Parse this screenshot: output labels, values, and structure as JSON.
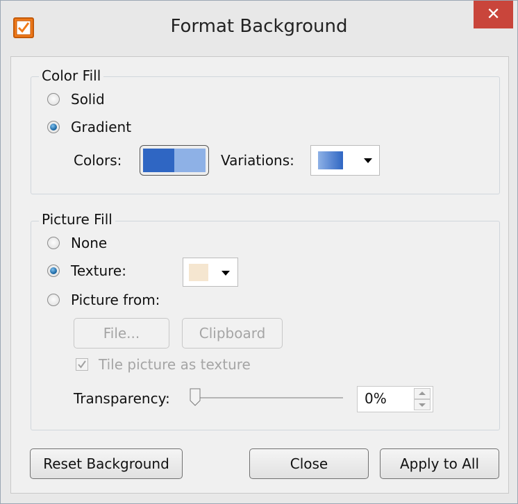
{
  "window": {
    "title": "Format Background",
    "close_glyph": "✕"
  },
  "color_fill": {
    "title": "Color Fill",
    "solid_label": "Solid",
    "gradient_label": "Gradient",
    "selected": "gradient",
    "colors_label": "Colors:",
    "colors": [
      "#2f66c3",
      "#8eb1e6"
    ],
    "variations_label": "Variations:"
  },
  "picture_fill": {
    "title": "Picture Fill",
    "none_label": "None",
    "texture_label": "Texture:",
    "picture_from_label": "Picture from:",
    "selected": "texture",
    "texture_color": "#f5e6d0",
    "file_button": "File...",
    "clipboard_button": "Clipboard",
    "tile_label": "Tile picture as texture",
    "tile_checked": true,
    "transparency_label": "Transparency:",
    "transparency_value": "0%",
    "transparency_percent": 0
  },
  "buttons": {
    "reset": "Reset Background",
    "close": "Close",
    "apply_all": "Apply to All"
  },
  "icons": {
    "app": "checkbox-app-icon",
    "close": "close-icon"
  }
}
